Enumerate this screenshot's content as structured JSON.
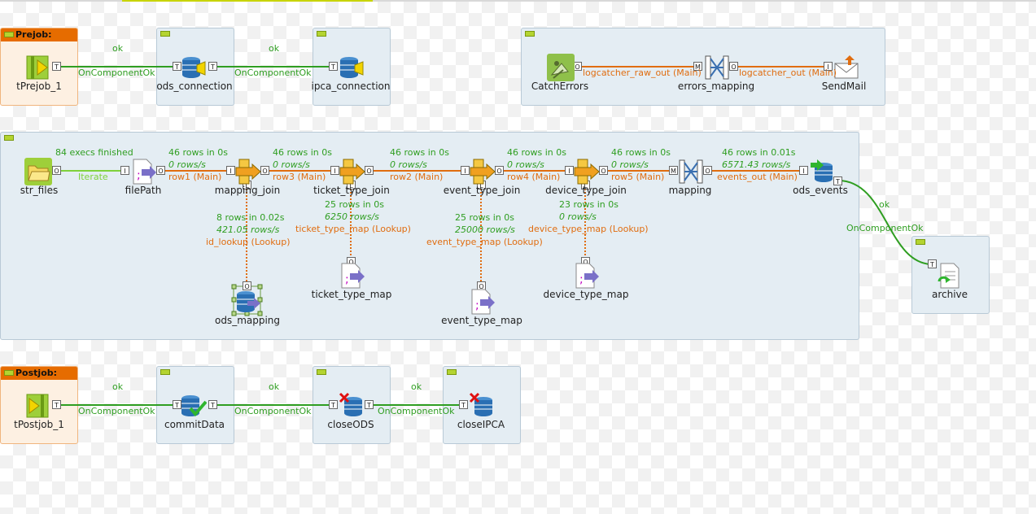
{
  "subjobs": {
    "prejob": "Prejob:",
    "postjob": "Postjob:"
  },
  "components": {
    "tprejob": "tPrejob_1",
    "ods_connection": "ods_connection",
    "ipca_connection": "ipca_connection",
    "catcherrors": "CatchErrors",
    "errors_mapping": "errors_mapping",
    "sendmail": "SendMail",
    "str_files": "str_files",
    "filepath": "filePath",
    "mapping_join": "mapping_join",
    "ticket_type_join": "ticket_type_join",
    "event_type_join": "event_type_join",
    "device_type_join": "device_type_join",
    "mapping": "mapping",
    "ods_events": "ods_events",
    "ods_mapping": "ods_mapping",
    "ticket_type_map": "ticket_type_map",
    "event_type_map": "event_type_map",
    "device_type_map": "device_type_map",
    "archive": "archive",
    "tpostjob": "tPostjob_1",
    "commitdata": "commitData",
    "closeods": "closeODS",
    "closeipca": "closeIPCA"
  },
  "links": {
    "ok": "ok",
    "oncomponentok": "OnComponentOk",
    "iterate": "Iterate",
    "execs": "84 execs finished",
    "row1": "row1 (Main)",
    "row3": "row3 (Main)",
    "row2": "row2 (Main)",
    "row4": "row4 (Main)",
    "row5": "row5 (Main)",
    "events_out": "events_out (Main)",
    "logcatcher_raw_out": "logcatcher_raw_out (Main)",
    "logcatcher_out": "logcatcher_out (Main)",
    "id_lookup": "id_lookup (Lookup)",
    "ticket_type_map_lookup": "ticket_type_map (Lookup)",
    "event_type_map_lookup": "event_type_map (Lookup)",
    "device_type_map_lookup": "device_type_map (Lookup)"
  },
  "stats": {
    "r46_0s": "46 rows in 0s",
    "r0_rows_s": "0 rows/s",
    "r46_001s": "46 rows in 0.01s",
    "r6571": "6571.43 rows/s",
    "r8": "8 rows in 0.02s",
    "r421": "421.05 rows/s",
    "r25": "25 rows in 0s",
    "r6250": "6250 rows/s",
    "r25000": "25000 rows/s",
    "r23": "23 rows in 0s"
  },
  "colors": {
    "main_link": "#e06d10",
    "trigger_link": "#2f9e21",
    "iterate_link": "#7fd13b",
    "subjob_bg": "#e4edf3",
    "prejob_bg": "#fdf0e2",
    "prejob_header": "#e66c00"
  }
}
